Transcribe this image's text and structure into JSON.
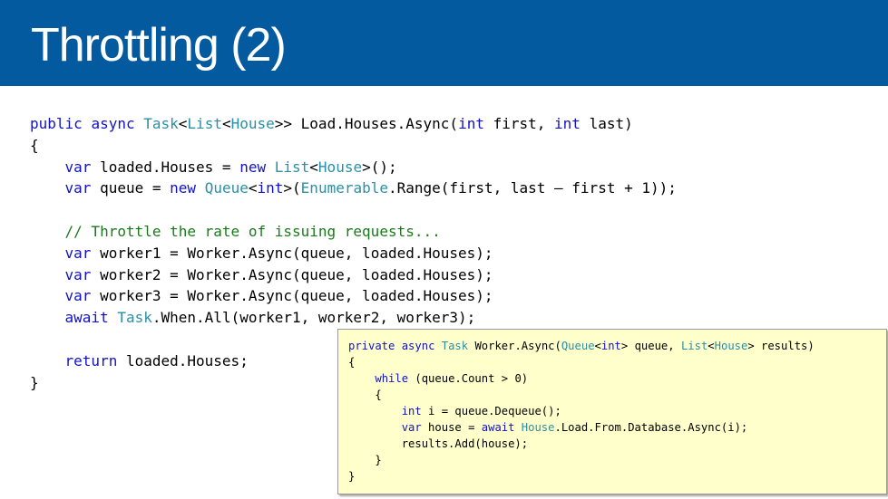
{
  "slide": {
    "title": "Throttling (2)"
  },
  "main_code": [
    [
      [
        "kw",
        "public"
      ],
      [
        "t",
        " "
      ],
      [
        "kw",
        "async"
      ],
      [
        "t",
        " "
      ],
      [
        "ty",
        "Task"
      ],
      [
        "t",
        "<"
      ],
      [
        "ty",
        "List"
      ],
      [
        "t",
        "<"
      ],
      [
        "ty",
        "House"
      ],
      [
        "t",
        ">> Load.Houses.Async("
      ],
      [
        "kw",
        "int"
      ],
      [
        "t",
        " first, "
      ],
      [
        "kw",
        "int"
      ],
      [
        "t",
        " last)"
      ]
    ],
    [
      [
        "t",
        "{"
      ]
    ],
    [
      [
        "t",
        "    "
      ],
      [
        "kw",
        "var"
      ],
      [
        "t",
        " loaded.Houses = "
      ],
      [
        "kw",
        "new"
      ],
      [
        "t",
        " "
      ],
      [
        "ty",
        "List"
      ],
      [
        "t",
        "<"
      ],
      [
        "ty",
        "House"
      ],
      [
        "t",
        ">();"
      ]
    ],
    [
      [
        "t",
        "    "
      ],
      [
        "kw",
        "var"
      ],
      [
        "t",
        " queue = "
      ],
      [
        "kw",
        "new"
      ],
      [
        "t",
        " "
      ],
      [
        "ty",
        "Queue"
      ],
      [
        "t",
        "<"
      ],
      [
        "kw",
        "int"
      ],
      [
        "t",
        ">("
      ],
      [
        "ty",
        "Enumerable"
      ],
      [
        "t",
        ".Range(first, last – first + 1));"
      ]
    ],
    [
      [
        "t",
        ""
      ]
    ],
    [
      [
        "t",
        "    "
      ],
      [
        "cm",
        "// Throttle the rate of issuing requests..."
      ]
    ],
    [
      [
        "t",
        "    "
      ],
      [
        "kw",
        "var"
      ],
      [
        "t",
        " worker1 = Worker.Async(queue, loaded.Houses);"
      ]
    ],
    [
      [
        "t",
        "    "
      ],
      [
        "kw",
        "var"
      ],
      [
        "t",
        " worker2 = Worker.Async(queue, loaded.Houses);"
      ]
    ],
    [
      [
        "t",
        "    "
      ],
      [
        "kw",
        "var"
      ],
      [
        "t",
        " worker3 = Worker.Async(queue, loaded.Houses);"
      ]
    ],
    [
      [
        "t",
        "    "
      ],
      [
        "kw",
        "await"
      ],
      [
        "t",
        " "
      ],
      [
        "ty",
        "Task"
      ],
      [
        "t",
        ".When.All(worker1, worker2, worker3);"
      ]
    ],
    [
      [
        "t",
        ""
      ]
    ],
    [
      [
        "t",
        "    "
      ],
      [
        "kw",
        "return"
      ],
      [
        "t",
        " loaded.Houses;"
      ]
    ],
    [
      [
        "t",
        "}"
      ]
    ]
  ],
  "popup_code": [
    [
      [
        "kw",
        "private"
      ],
      [
        "t",
        " "
      ],
      [
        "kw",
        "async"
      ],
      [
        "t",
        " "
      ],
      [
        "ty",
        "Task"
      ],
      [
        "t",
        " Worker.Async("
      ],
      [
        "ty",
        "Queue"
      ],
      [
        "t",
        "<"
      ],
      [
        "kw",
        "int"
      ],
      [
        "t",
        "> queue, "
      ],
      [
        "ty",
        "List"
      ],
      [
        "t",
        "<"
      ],
      [
        "ty",
        "House"
      ],
      [
        "t",
        "> results)"
      ]
    ],
    [
      [
        "t",
        "{"
      ]
    ],
    [
      [
        "t",
        "    "
      ],
      [
        "kw",
        "while"
      ],
      [
        "t",
        " (queue.Count > 0)"
      ]
    ],
    [
      [
        "t",
        "    {"
      ]
    ],
    [
      [
        "t",
        "        "
      ],
      [
        "kw",
        "int"
      ],
      [
        "t",
        " i = queue.Dequeue();"
      ]
    ],
    [
      [
        "t",
        "        "
      ],
      [
        "kw",
        "var"
      ],
      [
        "t",
        " house = "
      ],
      [
        "kw",
        "await"
      ],
      [
        "t",
        " "
      ],
      [
        "ty",
        "House"
      ],
      [
        "t",
        ".Load.From.Database.Async(i);"
      ]
    ],
    [
      [
        "t",
        "        results.Add(house);"
      ]
    ],
    [
      [
        "t",
        "    }"
      ]
    ],
    [
      [
        "t",
        "}"
      ]
    ]
  ],
  "colors": {
    "header_bg": "#035a9e",
    "keyword": "#1212c8",
    "type": "#2b8fa6",
    "comment": "#1a7a1a",
    "popup_bg": "#ffffcc"
  }
}
